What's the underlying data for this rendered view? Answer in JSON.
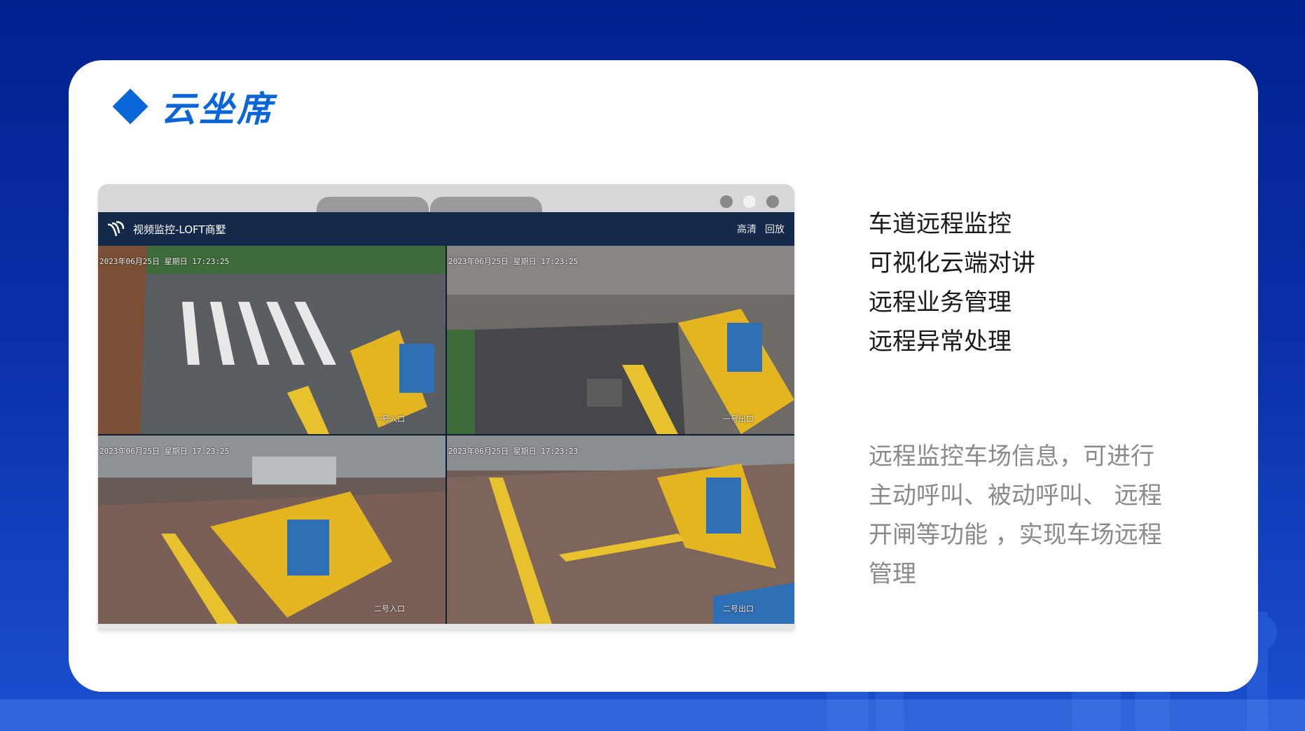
{
  "page": {
    "title": "云坐席"
  },
  "browser": {
    "app_title": "视频监控-LOFT商墅",
    "actions": [
      "高清",
      "回放"
    ]
  },
  "cameras": [
    {
      "timestamp": "2023年06月25日  星期日  17:23:25",
      "label": "一号入口"
    },
    {
      "timestamp": "2023年06月25日  星期日  17:23:25",
      "label": "一号出口"
    },
    {
      "timestamp": "2023年06月25日  星期日  17:23:25",
      "label": "二号入口"
    },
    {
      "timestamp": "2023年06月25日  星期日  17:23:23",
      "label": "二号出口"
    }
  ],
  "features": [
    "车道远程监控",
    "可视化云端对讲",
    "远程业务管理",
    "远程异常处理"
  ],
  "description": "远程监控车场信息，可进行主动呼叫、被动呼叫、 远程开闸等功能 ，实现车场远程管理",
  "colors": {
    "accent": "#0a66d8",
    "background": "#0a2fa8",
    "appbar": "#152a4a"
  }
}
